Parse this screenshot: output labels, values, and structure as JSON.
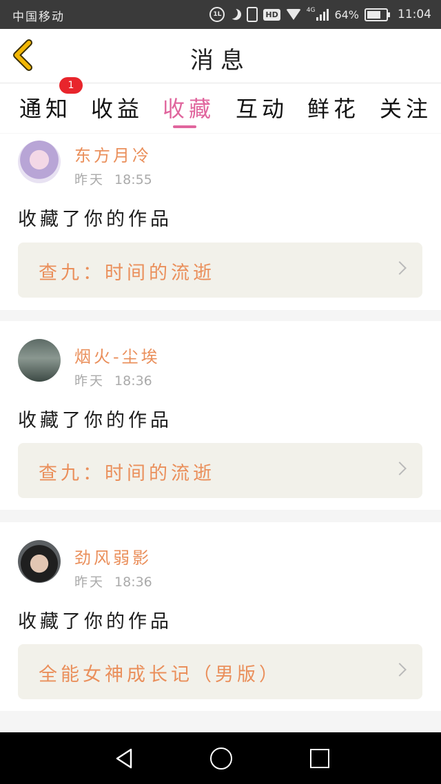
{
  "status_bar": {
    "carrier": "中国移动",
    "battery": "64%",
    "time": "11:04",
    "network": "4G",
    "icons": [
      "alarm-icon",
      "moon-icon",
      "vibrate-icon",
      "hd-icon",
      "wifi-icon",
      "signal-icon",
      "battery-icon"
    ]
  },
  "header": {
    "title": "消息",
    "back_icon": "chevron-left-icon"
  },
  "tabs": [
    {
      "label": "通知",
      "badge": "1"
    },
    {
      "label": "收益"
    },
    {
      "label": "收藏",
      "active": true
    },
    {
      "label": "互动"
    },
    {
      "label": "鲜花"
    },
    {
      "label": "关注"
    }
  ],
  "messages": [
    {
      "user": "东方月冷",
      "day": "昨天",
      "time": "18:55",
      "action": "收藏了你的作品",
      "work": "查九：时间的流逝"
    },
    {
      "user": "烟火-尘埃",
      "day": "昨天",
      "time": "18:36",
      "action": "收藏了你的作品",
      "work": "查九：时间的流逝"
    },
    {
      "user": "劲风弱影",
      "day": "昨天",
      "time": "18:36",
      "action": "收藏了你的作品",
      "work": "全能女神成长记（男版）"
    }
  ],
  "colors": {
    "accent": "#e0659d",
    "name_orange": "#ea8f5b",
    "badge_red": "#e8252c",
    "back_yellow": "#f2b705"
  },
  "nav_bar": {
    "icons": [
      "back-triangle-icon",
      "home-circle-icon",
      "recent-square-icon"
    ]
  }
}
